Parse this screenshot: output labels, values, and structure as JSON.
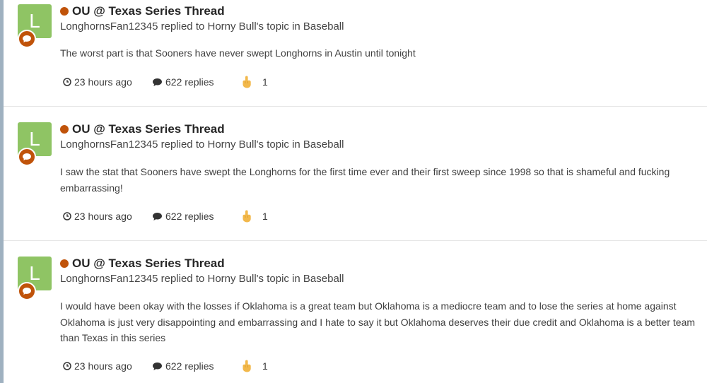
{
  "activity": [
    {
      "avatar_letter": "L",
      "title": "OU @ Texas Series Thread",
      "meta": "LonghornsFan12345 replied to Horny Bull's topic in Baseball",
      "snippet": "The worst part is that Sooners have never swept Longhorns in Austin until tonight",
      "time": "23 hours ago",
      "replies": "622 replies",
      "reaction_count": "1"
    },
    {
      "avatar_letter": "L",
      "title": "OU @ Texas Series Thread",
      "meta": "LonghornsFan12345 replied to Horny Bull's topic in Baseball",
      "snippet": "I saw the stat that Sooners have swept the Longhorns for the first time ever and their first sweep since 1998 so that is shameful and fucking embarrassing!",
      "time": "23 hours ago",
      "replies": "622 replies",
      "reaction_count": "1"
    },
    {
      "avatar_letter": "L",
      "title": "OU @ Texas Series Thread",
      "meta": "LonghornsFan12345 replied to Horny Bull's topic in Baseball",
      "snippet": "I would have been okay with the losses if Oklahoma is a great team but Oklahoma is a mediocre team and to lose the series at home against Oklahoma is just very disappointing and embarrassing and I hate to say it but Oklahoma deserves their due credit and Oklahoma is a better team than Texas in this series",
      "time": "23 hours ago",
      "replies": "622 replies",
      "reaction_count": "1"
    }
  ],
  "colors": {
    "accent": "#c0530a",
    "avatar_bg": "#8fc464",
    "reaction_skin": "#f2b84b"
  },
  "icons": {
    "comment_badge": "speech-bubble-icon",
    "time": "clock-icon",
    "replies": "comment-icon",
    "reaction": "hand-gesture-emoji-icon"
  }
}
